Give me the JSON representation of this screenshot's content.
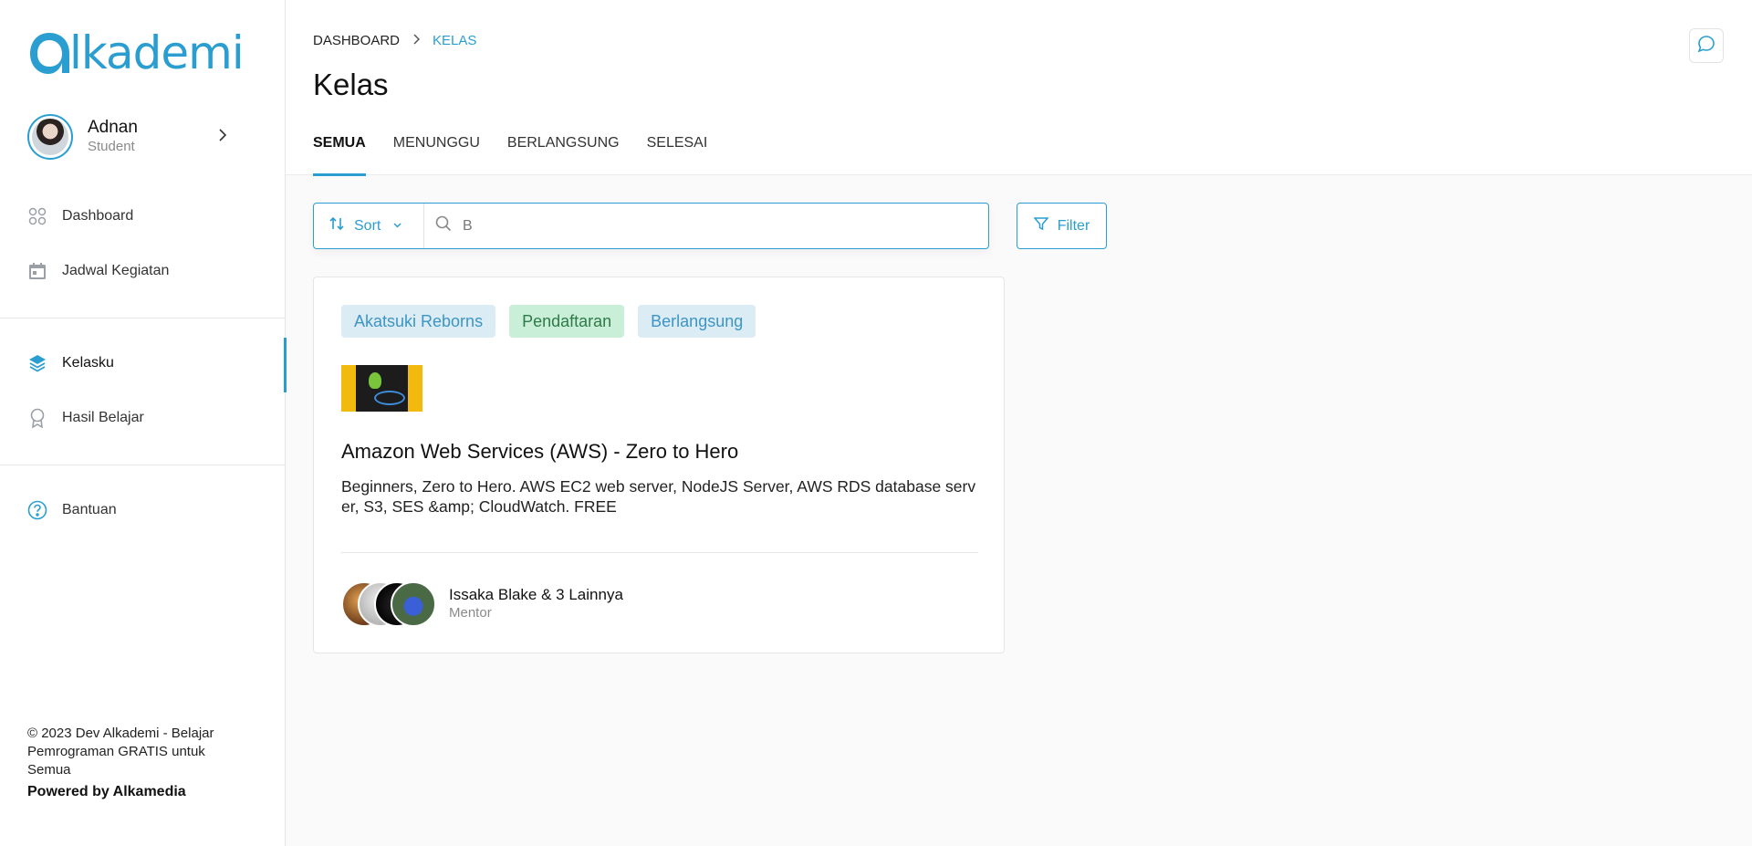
{
  "brand": {
    "logo_text": "lkademi"
  },
  "user": {
    "name": "Adnan",
    "role": "Student"
  },
  "sidebar": {
    "items": [
      {
        "label": "Dashboard",
        "icon": "grid-icon"
      },
      {
        "label": "Jadwal Kegiatan",
        "icon": "calendar-icon"
      },
      {
        "label": "Kelasku",
        "icon": "layers-icon",
        "active": true
      },
      {
        "label": "Hasil Belajar",
        "icon": "award-icon"
      },
      {
        "label": "Bantuan",
        "icon": "help-circle-icon"
      }
    ],
    "footer_text": "© 2023 Dev Alkademi - Belajar Pemrograman GRATIS untuk Semua",
    "powered_by": "Powered by Alkamedia"
  },
  "breadcrumb": {
    "items": [
      "DASHBOARD",
      "KELAS"
    ]
  },
  "page_title": "Kelas",
  "tabs": [
    {
      "label": "SEMUA",
      "active": true
    },
    {
      "label": "MENUNGGU"
    },
    {
      "label": "BERLANGSUNG"
    },
    {
      "label": "SELESAI"
    }
  ],
  "toolbar": {
    "sort_label": "Sort",
    "search_value": "B",
    "filter_label": "Filter"
  },
  "course": {
    "tags": [
      "Akatsuki Reborns",
      "Pendaftaran",
      "Berlangsung"
    ],
    "title": "Amazon Web Services (AWS) - Zero to Hero",
    "description": "Beginners, Zero to Hero. AWS EC2 web server, NodeJS Server, AWS RDS database server, S3, SES &amp; CloudWatch. FREE",
    "mentor_name": "Issaka Blake & 3 Lainnya",
    "mentor_role": "Mentor"
  },
  "colors": {
    "accent": "#2a9ed1",
    "tag_blue_bg": "#dcecf4",
    "tag_green_bg": "#c9efd8"
  }
}
